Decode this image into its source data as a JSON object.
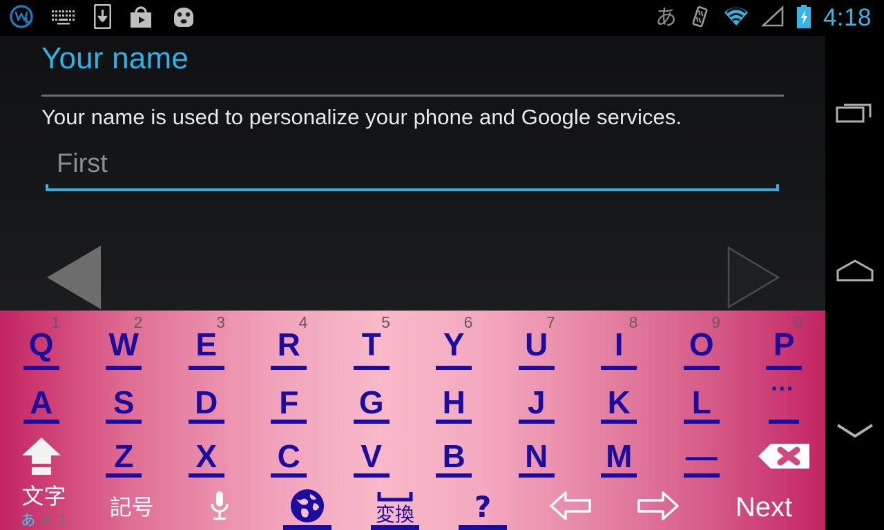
{
  "status_bar": {
    "left_icons": [
      {
        "name": "w-logo-icon",
        "label": "W"
      },
      {
        "name": "keyboard-icon",
        "label": "keyboard"
      },
      {
        "name": "download-to-device-icon",
        "label": "download"
      },
      {
        "name": "play-store-icon",
        "label": "play store"
      },
      {
        "name": "android-face-icon",
        "label": "android"
      }
    ],
    "ime_indicator": "あ",
    "right_icons": [
      {
        "name": "vibrate-icon",
        "label": "vibrate"
      },
      {
        "name": "wifi-icon",
        "label": "wifi"
      },
      {
        "name": "signal-icon",
        "label": "signal"
      },
      {
        "name": "battery-charging-icon",
        "label": "battery charging"
      }
    ],
    "clock": "4:18",
    "accent_color": "#33b5e5"
  },
  "setup": {
    "title": "Your name",
    "description": "Your name is used to personalize your phone and Google services.",
    "field": {
      "value": "",
      "placeholder": "First",
      "underline_color": "#2fb2e8"
    },
    "prev_label": "Back",
    "next_label": "Next"
  },
  "navbar": {
    "items": [
      {
        "name": "recents-icon",
        "label": "Recents"
      },
      {
        "name": "home-icon",
        "label": "Home"
      },
      {
        "name": "back-hide-keyboard-icon",
        "label": "Hide keyboard"
      }
    ]
  },
  "keyboard": {
    "key_color": "#1b0d9e",
    "row1": [
      {
        "letter": "Q",
        "digit": "1"
      },
      {
        "letter": "W",
        "digit": "2"
      },
      {
        "letter": "E",
        "digit": "3"
      },
      {
        "letter": "R",
        "digit": "4"
      },
      {
        "letter": "T",
        "digit": "5"
      },
      {
        "letter": "Y",
        "digit": "6"
      },
      {
        "letter": "U",
        "digit": "7"
      },
      {
        "letter": "I",
        "digit": "8"
      },
      {
        "letter": "O",
        "digit": "9"
      },
      {
        "letter": "P",
        "digit": "0"
      }
    ],
    "row2": [
      {
        "letter": "A"
      },
      {
        "letter": "S"
      },
      {
        "letter": "D"
      },
      {
        "letter": "F"
      },
      {
        "letter": "G"
      },
      {
        "letter": "H"
      },
      {
        "letter": "J"
      },
      {
        "letter": "K"
      },
      {
        "letter": "L"
      },
      {
        "letter": "⋯"
      }
    ],
    "row3": [
      {
        "letter": "shift",
        "icon": "shift-icon"
      },
      {
        "letter": "Z"
      },
      {
        "letter": "X"
      },
      {
        "letter": "C"
      },
      {
        "letter": "V"
      },
      {
        "letter": "B"
      },
      {
        "letter": "N"
      },
      {
        "letter": "M"
      },
      {
        "letter": "—"
      },
      {
        "letter": "backspace",
        "icon": "backspace-icon"
      }
    ],
    "row4": {
      "mode_label": "文字",
      "mode_sub": [
        "あ",
        "A",
        "1"
      ],
      "symbols_label": "記号",
      "mic_icon": "microphone-icon",
      "globe_icon": "globe-icon",
      "space_label": "変換",
      "question_label": "?",
      "arrow_left_icon": "arrow-left-icon",
      "arrow_right_icon": "arrow-right-icon",
      "enter_label": "Next"
    }
  }
}
